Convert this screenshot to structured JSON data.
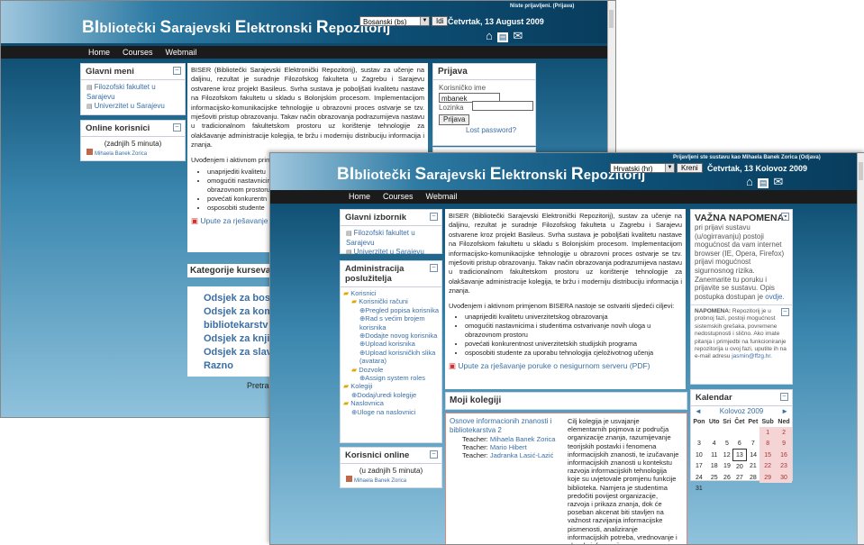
{
  "back": {
    "title_parts": [
      {
        "big": "BI",
        "small": "bliotečki "
      },
      {
        "big": "S",
        "small": "arajevski "
      },
      {
        "big": "E",
        "small": "lektronski "
      },
      {
        "big": "R",
        "small": "epozitorij"
      }
    ],
    "login_info": "Niste prijavljeni. (Prijava)",
    "language": "Bosanski (bs)",
    "go_label": "Idi",
    "date": "Četvrtak, 13 August 2009",
    "nav": [
      "Home",
      "Courses",
      "Webmail"
    ],
    "main_menu": {
      "title": "Glavni meni",
      "items": [
        "Filozofski fakultet u Sarajevu",
        "Univerzitet u Sarajevu"
      ]
    },
    "online": {
      "title": "Online korisnici",
      "subtitle": "(zadnjih 5 minuta)",
      "user": "Mihaela Banek Zorica"
    },
    "intro": "BISER (Bibliotečki Sarajevski Elektronički Repozitorij), sustav za učenje na daljinu, rezultat je suradnje Filozofskog fakulteta u Zagrebu i Sarajevu ostvarene kroz projekt Basileus. Svrha sustava je poboljšati kvalitetu nastave na Filozofskom fakultetu u skladu s Bolonjskim procesom. Implementacijom informacijsko-komunikacijske tehnologije u obrazovni proces ostvarje se tzv. mješoviti pristup obrazovanju. Takav način obrazovanja podrazumijeva nastavu u tradicionalnom fakultetskom prostoru uz korištenje tehnologije za olakšavanje administracije kolegija, te bržu i moderniju distribuciju informacija i znanja.",
    "goals_intro": "Uvođenjem i aktivnom primj",
    "bullets": [
      "unaprijediti kvalitetu",
      "omogućiti nastavnicim",
      "obrazovnom prostoru",
      "povećati konkurentn",
      "osposobiti studente"
    ],
    "upute": "Upute za rješavanje",
    "categories_title": "Kategorije kurseva",
    "categories": [
      "Odsjek za bos",
      "Odsjek za kom",
      "bibliotekarstv",
      "Odsjek za knji",
      "Odsjek za slav",
      "Razno"
    ],
    "search_label": "Pretra",
    "login": {
      "title": "Prijava",
      "user_label": "Korisničko ime",
      "user_value": "mbanek",
      "pass_label": "Lozinka",
      "button": "Prijava",
      "lost": "Lost password?"
    }
  },
  "front": {
    "title_parts": [
      {
        "big": "BI",
        "small": "bliotečki "
      },
      {
        "big": "S",
        "small": "arajevski "
      },
      {
        "big": "E",
        "small": "lektronski "
      },
      {
        "big": "R",
        "small": "epozitorij"
      }
    ],
    "login_info": "Prijavljeni ste sustavu kao Mihaela Banek Zorica (Odjava)",
    "language": "Hrvatski (hr)",
    "go_label": "Kreni",
    "date": "Četvrtak, 13 Kolovoz 2009",
    "nav": [
      "Home",
      "Courses",
      "Webmail"
    ],
    "main_menu": {
      "title": "Glavni izbornik",
      "items": [
        "Filozofski fakultet u Sarajevu",
        "Univerzitet u Sarajevu"
      ]
    },
    "admin": {
      "title_line1": "Administracija",
      "title_line2": "poslužitelja",
      "korisnici": "Korisnici",
      "korisnicki_racuni": "Korisnički računi",
      "sub_items": [
        "Pregled popisa korisnika",
        "Rad s većim brojem korisnika",
        "Dodajte novog korisnika",
        "Upload korisnika",
        "Upload korisničkih slika (avatara)"
      ],
      "dozvole": "Dozvole",
      "assign": "Assign system roles",
      "kolegiji": "Kolegiji",
      "dodaj": "Dodaj/uredi kolegije",
      "naslovnica": "Naslovnica",
      "uloge": "Uloge na naslovnici"
    },
    "online": {
      "title": "Korisnici online",
      "subtitle": "(u zadnjih 5 minuta)",
      "user": "Mihaela Banek Zorica"
    },
    "intro": "BISER (Bibliotečki Sarajevski Elektronički Repozitorij), sustav za učenje na daljinu, rezultat je suradnje Filozofskog fakulteta u Zagrebu i Sarajevu ostvarene kroz projekt Basileus. Svrha sustava je poboljšati kvalitetu nastave na Filozofskom fakultetu u skladu s Bolonjskim procesom. Implementacijom informacijsko-komunikacijske tehnologije u obrazovni proces ostvarje se tzv. mješoviti pristup obrazovanju. Takav način obrazovanja podrazumijeva nastavu u tradicionalnom fakultetskom prostoru uz korištenje tehnologije za olakšavanje administracije kolegija, te bržu i moderniju distribuciju informacija i znanja.",
    "goals_intro": "Uvođenjem i aktivnom primjenom BISERA nastoje se ostvariti sljedeći ciljevi:",
    "bullets": [
      "unaprijediti kvalitetu univerzitetskog obrazovanja",
      "omogućiti nastavnicima i studentima ostvarivanje novih uloga u obrazovnom prostoru",
      "povećati konkurentnost univerzitetskih studijskih programa",
      "osposobiti studente za uporabu tehnologija cjeloživotnog učenja"
    ],
    "upute": "Upute za rješavanje poruke o nesigurnom serveru (PDF)",
    "moji_kolegiji": "Moji kolegiji",
    "course": {
      "title": "Osnove informacionih znanosti i bibliotekarstva 2",
      "teachers": [
        {
          "role": "Teacher:",
          "name": "Mihaela Banek Zorica"
        },
        {
          "role": "Teacher:",
          "name": "Mario Hibert"
        },
        {
          "role": "Teacher:",
          "name": "Jadranka Lasić-Lazić"
        }
      ],
      "description": "Cilj kolegija je usvajanje elementarnih pojmova iz područja organizacije znanja, razumijevanje teorijskih postavki i fenomena informacijskih znanosti, te izučavanje informacijskih znanosti u kontekstu razvoja informacijskih tehnologija koje su uvjetovale promjenu funkcije biblioteka. Namjera je studentima predočiti povijest organizacije, razvoja i prikaza znanja, dok će poseban akcenat biti stavljen na važnost razvijanja informacijske pismenosti, analiziranje informacijskih potreba, vrednovanje i obradu informacija."
    },
    "notice": {
      "title": "VAŽNA NAPOMENA:",
      "text": "pri prijavi sustavu (u/ogirravanju) postoji mogućnost da vam internet browser (IE, Opera, Firefox) prijavi mogućnost sigurnosnog rizika. Zanemarite tu poruku i prijavite se sustavu. Opis postupka dostupan je",
      "link": "ovdje."
    },
    "note2": {
      "label": "NAPOMENA:",
      "text": "Repozitorij je u probnoj fazi, postoji mogućnost sistemskih grešaka, povremene nedostupnosti i slično. Ako imate pitanja i primjedbi na funkcioniranje repozitorija u ovoj fazi, uputite ih na e-mail adresu",
      "email": "jasmin@ffzg.hr."
    },
    "calendar": {
      "title": "Kalendar",
      "month": "Kolovoz 2009",
      "prev": "◄",
      "next": "►",
      "days": [
        "Pon",
        "Uto",
        "Sri",
        "Čet",
        "Pet",
        "Sub",
        "Ned"
      ],
      "weeks": [
        [
          "",
          "",
          "",
          "",
          "",
          "1",
          "2"
        ],
        [
          "3",
          "4",
          "5",
          "6",
          "7",
          "8",
          "9"
        ],
        [
          "10",
          "11",
          "12",
          "13",
          "14",
          "15",
          "16"
        ],
        [
          "17",
          "18",
          "19",
          "20",
          "21",
          "22",
          "23"
        ],
        [
          "24",
          "25",
          "26",
          "27",
          "28",
          "29",
          "30"
        ],
        [
          "31",
          "",
          "",
          "",
          "",
          "",
          ""
        ]
      ],
      "today": "13"
    }
  }
}
